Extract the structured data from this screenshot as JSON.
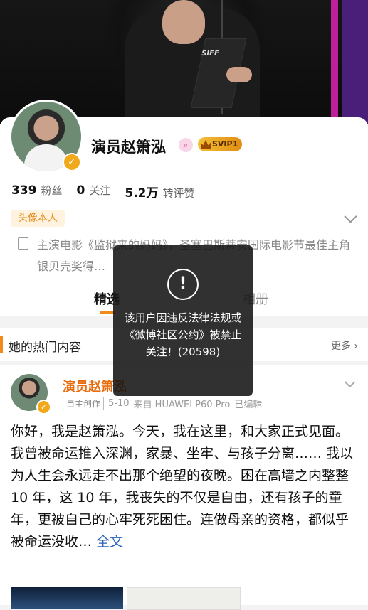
{
  "profile": {
    "name": "演员赵箫泓",
    "svip_label": "SVIP1",
    "stats": [
      {
        "value": "339",
        "label": "粉丝"
      },
      {
        "value": "0",
        "label": "关注"
      },
      {
        "value": "5.2万",
        "label": "转评赞"
      }
    ],
    "badge": "头像本人",
    "intro": "主演电影《监狱来的妈妈》，圣塞巴斯蒂安国际电影节最佳主角银贝壳奖得…",
    "banner_logo": "SIFF"
  },
  "tabs": [
    "精选",
    "相册"
  ],
  "hot_section": {
    "title": "她的热门内容",
    "more": "更多 ›"
  },
  "post": {
    "author": "演员赵箫泓",
    "source_tag": "自主创作",
    "date": "5-10",
    "device": "来自 HUAWEI P60 Pro",
    "edited": "已编辑",
    "text": "你好，我是赵箫泓。今天，我在这里，和大家正式见面。 我曾被命运推入深渊，家暴、坐牢、与孩子分离…… 我以为人生会永远走不出那个绝望的夜晚。困在高墙之内整整 10 年，这 10 年，我丧失的不仅是自由，还有孩子的童年，更被自己的心牢死死困住。连做母亲的资格，都似乎被命运没收…",
    "full_text_link": "全文"
  },
  "toast": {
    "icon": "!",
    "message": "该用户因违反法律法规或《微博社区公约》被禁止关注！(20598)"
  },
  "colors": {
    "accent": "#f08a1a",
    "name_orange": "#e86b0c",
    "link_blue": "#2a63b9"
  }
}
